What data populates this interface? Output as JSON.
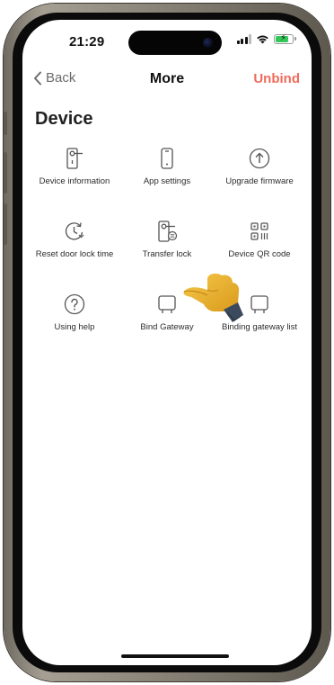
{
  "status_bar": {
    "time": "21:29",
    "battery_color": "#34c759"
  },
  "nav": {
    "back_label": "Back",
    "title": "More",
    "unbind_label": "Unbind",
    "unbind_color": "#f06b5b"
  },
  "section": {
    "title": "Device"
  },
  "items": [
    {
      "label": "Device information",
      "icon": "lock-info-icon"
    },
    {
      "label": "App settings",
      "icon": "phone-icon"
    },
    {
      "label": "Upgrade firmware",
      "icon": "upload-arrow-icon"
    },
    {
      "label": "Reset door lock time",
      "icon": "clock-reset-icon"
    },
    {
      "label": "Transfer lock",
      "icon": "lock-transfer-icon"
    },
    {
      "label": "Device QR code",
      "icon": "qr-code-icon"
    },
    {
      "label": "Using help",
      "icon": "help-icon"
    },
    {
      "label": "Bind Gateway",
      "icon": "gateway-icon"
    },
    {
      "label": "Binding gateway list",
      "icon": "gateway-icon"
    }
  ]
}
